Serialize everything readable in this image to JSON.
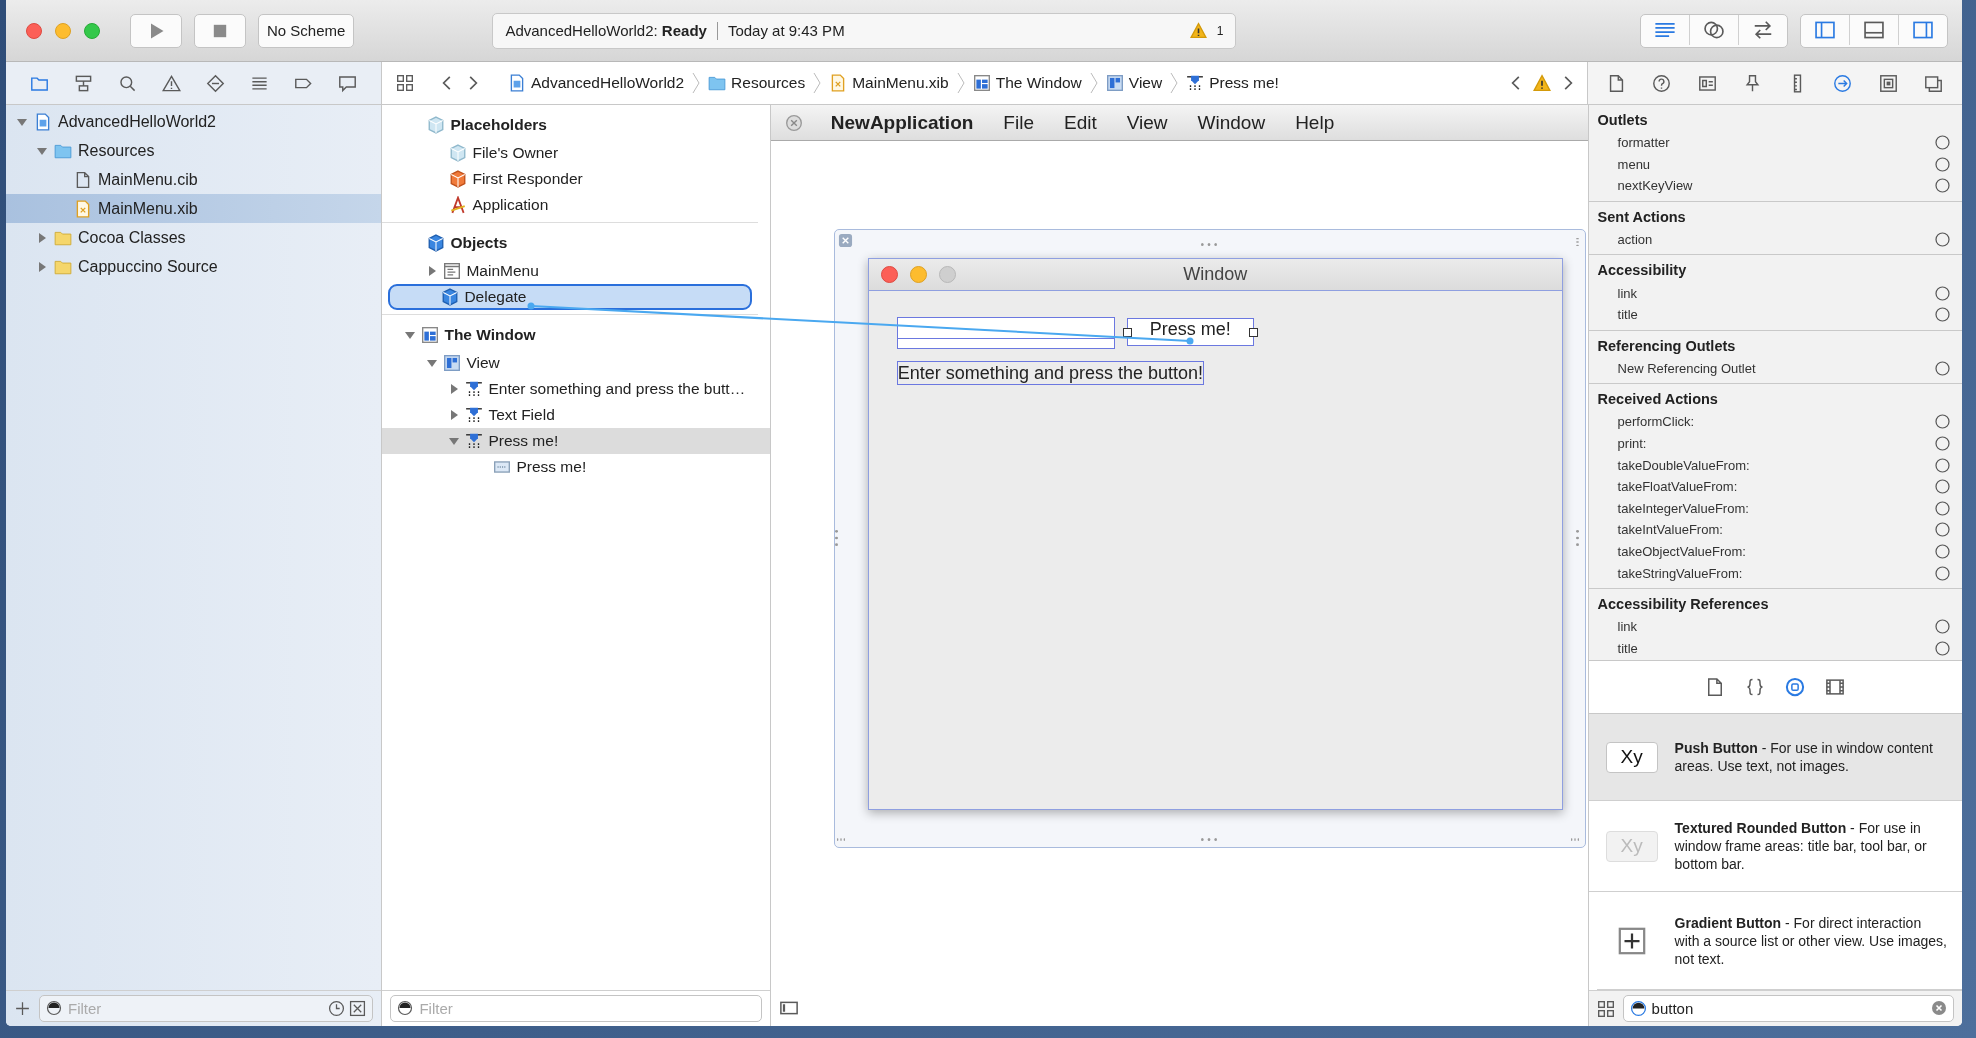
{
  "toolbar": {
    "scheme": "No Scheme",
    "status": "AdvancedHelloWorld2: **Ready**",
    "time": "Today at 9:43 PM",
    "warnings": "1",
    "editors": [
      {
        "kind": "lines",
        "selected": true
      },
      {
        "kind": "rings",
        "selected": false
      },
      {
        "kind": "arrows",
        "selected": false
      }
    ],
    "panels": [
      {
        "kind": "panel-left",
        "selected": true
      },
      {
        "kind": "panel-bottom",
        "selected": false
      },
      {
        "kind": "panel-right",
        "selected": true
      }
    ]
  },
  "navigator": {
    "tabs": [
      {
        "kind": "folder",
        "selected": true
      },
      {
        "kind": "hierarchy",
        "selected": false
      },
      {
        "kind": "search",
        "selected": false
      },
      {
        "kind": "warning",
        "selected": false
      },
      {
        "kind": "diamond",
        "selected": false
      },
      {
        "kind": "list",
        "selected": false
      },
      {
        "kind": "tag",
        "selected": false
      },
      {
        "kind": "bubble",
        "selected": false
      }
    ],
    "tree": [
      {
        "label": "AdvancedHelloWorld2",
        "kind": "project",
        "expanded": true,
        "selected": false,
        "children": [
          {
            "label": "Resources",
            "kind": "folder-blue",
            "expanded": true,
            "selected": false,
            "children": [
              {
                "label": "MainMenu.cib",
                "kind": "file",
                "selected": false
              },
              {
                "label": "MainMenu.xib",
                "kind": "xib",
                "selected": true
              }
            ]
          },
          {
            "label": "Cocoa Classes",
            "kind": "folder-yellow",
            "expanded": false,
            "selected": false
          },
          {
            "label": "Cappuccino Source",
            "kind": "folder-yellow",
            "expanded": false,
            "selected": false
          }
        ]
      }
    ],
    "filter": {
      "placeholder": "Filter"
    }
  },
  "jump_bar": [
    {
      "label": "AdvancedHelloWorld2",
      "kind": "project"
    },
    {
      "label": "Resources",
      "kind": "folder-blue"
    },
    {
      "label": "MainMenu.xib",
      "kind": "xib"
    },
    {
      "label": "The Window",
      "kind": "window"
    },
    {
      "label": "View",
      "kind": "view"
    },
    {
      "label": "Press me!",
      "kind": "control"
    }
  ],
  "outline": {
    "groups": [
      {
        "title": "Placeholders",
        "kind": "cube-light",
        "items": [
          {
            "label": "File's Owner",
            "kind": "cube-light",
            "selected": false,
            "drop_target": false
          },
          {
            "label": "First Responder",
            "kind": "cube-orange",
            "selected": false,
            "drop_target": false
          },
          {
            "label": "Application",
            "kind": "app",
            "selected": false,
            "drop_target": false
          }
        ]
      },
      {
        "title": "Objects",
        "kind": "cube",
        "items": [
          {
            "label": "MainMenu",
            "kind": "menu",
            "expanded": false,
            "selected": false,
            "drop_target": false
          },
          {
            "label": "Delegate",
            "kind": "cube",
            "selected": false,
            "drop_target": true
          }
        ]
      },
      {
        "title": "The Window",
        "kind": "window",
        "expanded": true,
        "items": [
          {
            "label": "View",
            "kind": "view",
            "expanded": true,
            "selected": false,
            "drop_target": false,
            "children": [
              {
                "label": "Enter something and press the butt…",
                "kind": "control",
                "expanded": false,
                "selected": false,
                "drop_target": false
              },
              {
                "label": "Text Field",
                "kind": "control",
                "expanded": false,
                "selected": false,
                "drop_target": false
              },
              {
                "label": "Press me!",
                "kind": "control",
                "expanded": true,
                "selected": true,
                "drop_target": false,
                "children": [
                  {
                    "label": "Press me!",
                    "kind": "cell",
                    "selected": false,
                    "drop_target": false
                  }
                ]
              }
            ]
          }
        ]
      }
    ],
    "filter": {
      "placeholder": "Filter"
    }
  },
  "canvas": {
    "menu_bar": [
      "NewApplication",
      "File",
      "Edit",
      "View",
      "Window",
      "Help"
    ],
    "window": {
      "title": "Window",
      "button": "Press me!",
      "label": "Enter something and press the button!"
    }
  },
  "inspector": {
    "tabs": [
      {
        "kind": "file",
        "selected": false
      },
      {
        "kind": "question",
        "selected": false
      },
      {
        "kind": "idcard",
        "selected": false
      },
      {
        "kind": "pin",
        "selected": false
      },
      {
        "kind": "ruler",
        "selected": false
      },
      {
        "kind": "arrow-circle",
        "selected": true
      },
      {
        "kind": "nested",
        "selected": false
      },
      {
        "kind": "layers",
        "selected": false
      }
    ],
    "sections": [
      {
        "title": "Outlets",
        "rows": [
          {
            "name": "formatter",
            "connected": false
          },
          {
            "name": "menu",
            "connected": false
          },
          {
            "name": "nextKeyView",
            "connected": false
          }
        ]
      },
      {
        "title": "Sent Actions",
        "rows": [
          {
            "name": "action",
            "connected": false
          }
        ]
      },
      {
        "title": "Accessibility",
        "rows": [
          {
            "name": "link",
            "connected": false
          },
          {
            "name": "title",
            "connected": false
          }
        ]
      },
      {
        "title": "Referencing Outlets",
        "rows": [
          {
            "name": "New Referencing Outlet",
            "connected": false
          }
        ]
      },
      {
        "title": "Received Actions",
        "rows": [
          {
            "name": "performClick:",
            "connected": false
          },
          {
            "name": "print:",
            "connected": false
          },
          {
            "name": "takeDoubleValueFrom:",
            "connected": false
          },
          {
            "name": "takeFloatValueFrom:",
            "connected": false
          },
          {
            "name": "takeIntegerValueFrom:",
            "connected": false
          },
          {
            "name": "takeIntValueFrom:",
            "connected": false
          },
          {
            "name": "takeObjectValueFrom:",
            "connected": false
          },
          {
            "name": "takeStringValueFrom:",
            "connected": false
          }
        ]
      },
      {
        "title": "Accessibility References",
        "rows": [
          {
            "name": "link",
            "connected": false
          },
          {
            "name": "title",
            "connected": false
          }
        ]
      }
    ]
  },
  "library": {
    "tabs": [
      {
        "kind": "file",
        "selected": false
      },
      {
        "kind": "braces",
        "selected": false
      },
      {
        "kind": "object",
        "selected": true
      },
      {
        "kind": "film",
        "selected": false
      }
    ],
    "items": [
      {
        "kind": "push",
        "sample": "Xy",
        "text": "**Push Button** - For use in window content areas. Use text, not images.",
        "selected": true
      },
      {
        "kind": "textured",
        "sample": "Xy",
        "text": "**Textured Rounded Button** - For use in window frame areas: title bar, tool bar, or bottom bar.",
        "selected": false
      },
      {
        "kind": "gradient",
        "text": "**Gradient Button** - For direct interaction with a source list or other view. Use images, not text.",
        "selected": false
      }
    ],
    "search": {
      "value": "button"
    }
  }
}
